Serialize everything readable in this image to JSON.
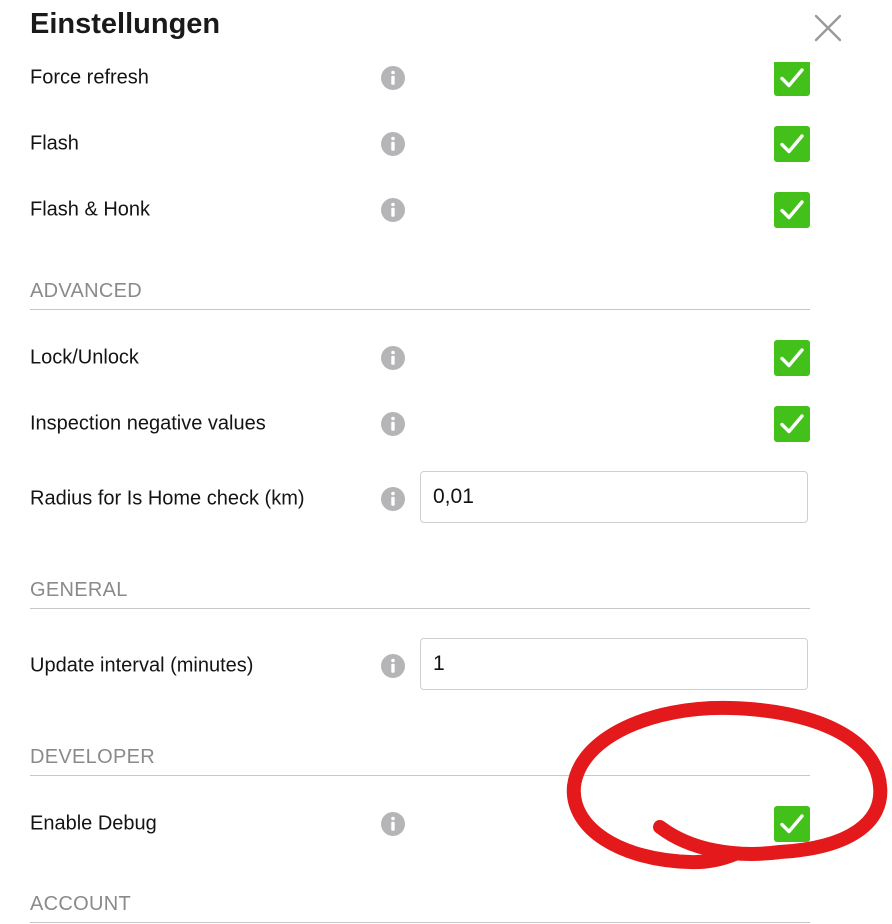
{
  "header": {
    "title": "Einstellungen",
    "close_icon": "close-x-icon"
  },
  "colors": {
    "check_green": "#43c11a",
    "info_gray": "#b5b5b8",
    "annotation_red": "#e3191b"
  },
  "rows_top": [
    {
      "label": "Force refresh",
      "checked": true
    },
    {
      "label": "Flash",
      "checked": true
    },
    {
      "label": "Flash & Honk",
      "checked": true
    }
  ],
  "sections": {
    "advanced": "ADVANCED",
    "general": "GENERAL",
    "developer": "DEVELOPER",
    "account": "ACCOUNT"
  },
  "advanced": {
    "lock_unlock": {
      "label": "Lock/Unlock",
      "checked": true
    },
    "inspection": {
      "label": "Inspection negative values",
      "checked": true
    },
    "radius": {
      "label": "Radius for Is Home check (km)",
      "value": "0,01"
    }
  },
  "general": {
    "update_interval": {
      "label": "Update interval (minutes)",
      "value": "1"
    }
  },
  "developer": {
    "enable_debug": {
      "label": "Enable Debug",
      "checked": true
    }
  }
}
